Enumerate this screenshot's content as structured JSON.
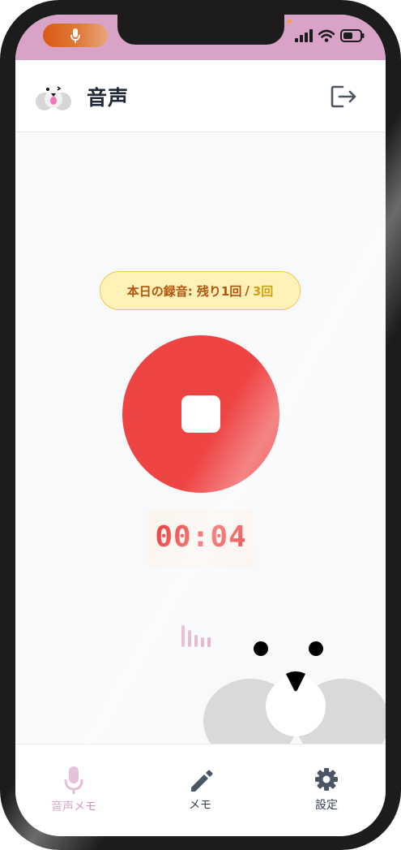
{
  "status_bar": {
    "recording_indicator_icon": "microphone-icon",
    "indicator_color": "#d95a12",
    "icons": [
      "signal-bars-icon",
      "wifi-icon",
      "battery-icon"
    ]
  },
  "header": {
    "title": "音声",
    "logout_icon": "logout-icon"
  },
  "quota": {
    "label": "本日の録音: 残り1回",
    "separator": "/",
    "total": "3回"
  },
  "recorder": {
    "state": "recording",
    "button_color": "#ef4444",
    "stop_icon": "stop-square-icon",
    "elapsed": "00:04",
    "level_meter_fractions": [
      0.9,
      0.7,
      0.5,
      0.4,
      0.4
    ]
  },
  "nav": {
    "items": [
      {
        "label": "音声メモ",
        "icon": "microphone-icon",
        "active": true
      },
      {
        "label": "メモ",
        "icon": "pencil-icon",
        "active": false
      },
      {
        "label": "設定",
        "icon": "gear-icon",
        "active": false
      }
    ],
    "active_color": "#c97fb2"
  }
}
